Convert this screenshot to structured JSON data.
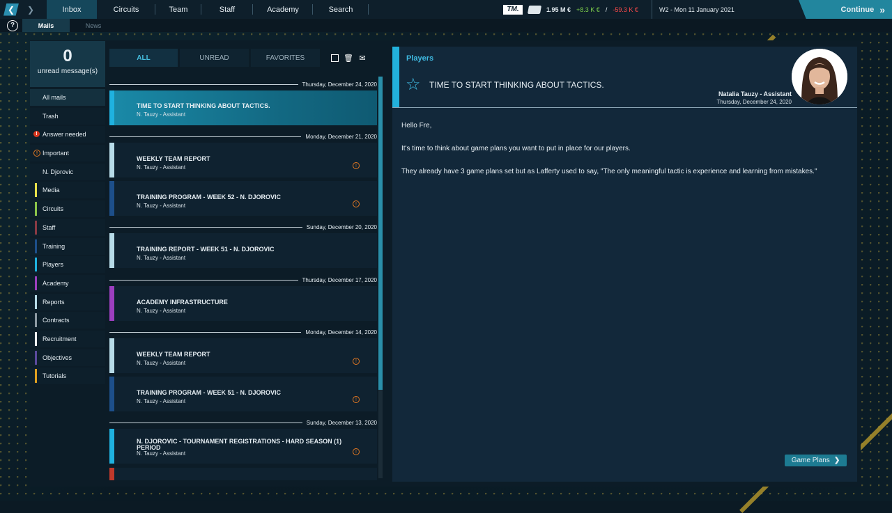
{
  "topbar": {
    "tabs": [
      {
        "label": "Inbox",
        "active": true
      },
      {
        "label": "Circuits"
      },
      {
        "label": "Team"
      },
      {
        "label": "Staff"
      },
      {
        "label": "Academy"
      },
      {
        "label": "Search"
      }
    ],
    "logo_text": "TM.",
    "balance": "1.95 M €",
    "income": "+8.3 K €",
    "separator": "/",
    "expense": "-59.3 K €",
    "date": "W2 - Mon 11 January 2021",
    "continue_label": "Continue"
  },
  "subbar": {
    "tabs": [
      {
        "label": "Mails",
        "active": true
      },
      {
        "label": "News"
      }
    ]
  },
  "unread": {
    "count": "0",
    "label": "unread message(s)"
  },
  "sidebar": {
    "items": [
      {
        "label": "All mails",
        "color": ""
      },
      {
        "label": "Trash",
        "color": ""
      },
      {
        "label": "Answer needed",
        "icon": "alert-icon"
      },
      {
        "label": "Important",
        "icon": "warning-icon"
      },
      {
        "label": "N. Djorovic",
        "color": ""
      },
      {
        "label": "Media",
        "color": "#e8e04a"
      },
      {
        "label": "Circuits",
        "color": "#8bc34a"
      },
      {
        "label": "Staff",
        "color": "#8a3a44"
      },
      {
        "label": "Training",
        "color": "#1d4f8a"
      },
      {
        "label": "Players",
        "color": "#1fb2e0"
      },
      {
        "label": "Academy",
        "color": "#9c3fbf"
      },
      {
        "label": "Reports",
        "color": "#b7dbe8"
      },
      {
        "label": "Contracts",
        "color": "#8e9aa3"
      },
      {
        "label": "Recruitment",
        "color": "#f2f4f5"
      },
      {
        "label": "Objectives",
        "color": "#5b4a9e"
      },
      {
        "label": "Tutorials",
        "color": "#e0a020"
      }
    ]
  },
  "filters": {
    "tabs": [
      {
        "label": "ALL",
        "active": true
      },
      {
        "label": "UNREAD"
      },
      {
        "label": "FAVORITES"
      }
    ]
  },
  "mails": {
    "date_groups": [
      "Thursday, December 24, 2020",
      "Monday, December 21, 2020",
      "Sunday, December 20, 2020",
      "Thursday, December 17, 2020",
      "Monday, December 14, 2020",
      "Sunday, December 13, 2020"
    ],
    "items": [
      {
        "subject": "TIME TO START THINKING ABOUT TACTICS.",
        "from": "N. Tauzy - Assistant",
        "color": "#1fb2e0",
        "alert": false,
        "selected": true
      },
      {
        "subject": "WEEKLY TEAM REPORT",
        "from": "N. Tauzy - Assistant",
        "color": "#b7dbe8",
        "alert": true
      },
      {
        "subject": "TRAINING PROGRAM - WEEK 52 - N. DJOROVIC",
        "from": "N. Tauzy - Assistant",
        "color": "#1d4f8a",
        "alert": true
      },
      {
        "subject": "TRAINING REPORT - WEEK 51 - N. DJOROVIC",
        "from": "N. Tauzy - Assistant",
        "color": "#b7dbe8",
        "alert": false
      },
      {
        "subject": "ACADEMY INFRASTRUCTURE",
        "from": "N. Tauzy - Assistant",
        "color": "#9c3fbf",
        "alert": false
      },
      {
        "subject": "WEEKLY TEAM REPORT",
        "from": "N. Tauzy - Assistant",
        "color": "#b7dbe8",
        "alert": true
      },
      {
        "subject": "TRAINING PROGRAM - WEEK 51 - N. DJOROVIC",
        "from": "N. Tauzy - Assistant",
        "color": "#1d4f8a",
        "alert": true
      },
      {
        "subject": "N. DJOROVIC - TOURNAMENT REGISTRATIONS - HARD SEASON (1) PERIOD",
        "from": "N. Tauzy - Assistant",
        "color": "#1fb2e0",
        "alert": true
      }
    ]
  },
  "reader": {
    "category": "Players",
    "title": "TIME TO START THINKING ABOUT TACTICS.",
    "sender": "Natalia Tauzy - Assistant",
    "date": "Thursday, December 24, 2020",
    "body": [
      "Hello Fre,",
      "It's time to think about game plans you want to put in place for our players.",
      "They already have 3 game plans set but as Lafferty used to say, \"The only meaningful tactic is experience and learning from mistakes.\""
    ],
    "action_label": "Game Plans"
  },
  "colors": {
    "accent": "#22b1dc",
    "positive": "#7fd14b",
    "negative": "#ff4a4a"
  }
}
